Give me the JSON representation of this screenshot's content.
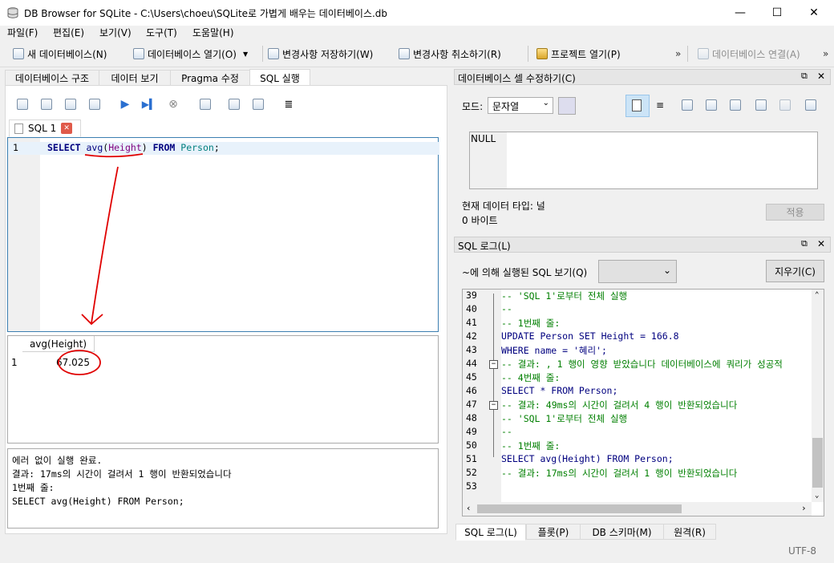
{
  "window": {
    "title": "DB Browser for SQLite - C:\\Users\\choeu\\SQLite로 가볍게 배우는 데이터베이스.db",
    "minimize": "—",
    "maximize": "☐",
    "close": "✕"
  },
  "menu": [
    "파일(F)",
    "편집(E)",
    "보기(V)",
    "도구(T)",
    "도움말(H)"
  ],
  "toolbar": {
    "new_db": "새 데이터베이스(N)",
    "open_db": "데이터베이스 열기(O)",
    "write_changes": "변경사항 저장하기(W)",
    "revert_changes": "변경사항 취소하기(R)",
    "open_project": "프로젝트 열기(P)",
    "overflow1": "»",
    "attach_db": "데이터베이스 연결(A)",
    "overflow2": "»"
  },
  "main_tabs": [
    "데이터베이스 구조",
    "데이터 보기",
    "Pragma 수정",
    "SQL 실행"
  ],
  "sql_tab": {
    "label": "SQL 1",
    "close": "✕"
  },
  "editor": {
    "line_number": "1",
    "tokens": [
      "SELECT",
      " ",
      "avg",
      "(",
      "Height",
      ")",
      " ",
      "FROM",
      " ",
      "Person",
      ";"
    ]
  },
  "results": {
    "column": "avg(Height)",
    "row_number": "1",
    "value": "67.025"
  },
  "message": {
    "line1": "에러 없이 실행 완료.",
    "line2": "결과: 17ms의 시간이 걸려서 1 행이 반환되었습니다",
    "line3": "1번째 줄:",
    "line4": "SELECT avg(Height) FROM Person;"
  },
  "cell_editor": {
    "title": "데이터베이스 셀 수정하기(C)",
    "mode_label": "모드:",
    "mode_value": "문자열",
    "content": "NULL",
    "type_label": "현재 데이터 타입: 널",
    "size_label": "0 바이트",
    "apply": "적용"
  },
  "sql_log": {
    "title": "SQL 로그(L)",
    "filter_label": "~에 의해 실행된 SQL 보기(Q)",
    "clear": "지우기(C)",
    "lines": [
      {
        "n": "39",
        "text": "-- 'SQL 1'로부터 전체 실행",
        "cls": "cmt"
      },
      {
        "n": "40",
        "text": "--",
        "cls": "cmt"
      },
      {
        "n": "41",
        "text": "-- 1번째 줄:",
        "cls": "cmt"
      },
      {
        "n": "42",
        "text": "UPDATE Person SET Height = 166.8",
        "cls": "sql1"
      },
      {
        "n": "43",
        "text": "WHERE name = '혜리';",
        "cls": "sql2"
      },
      {
        "n": "44",
        "text": "-- 결과: , 1 행이 영향 받았습니다 데이터베이스에 쿼리가 성공적",
        "cls": "cmt"
      },
      {
        "n": "45",
        "text": "-- 4번째 줄:",
        "cls": "cmt"
      },
      {
        "n": "46",
        "text": "SELECT * FROM Person;",
        "cls": "sql3"
      },
      {
        "n": "47",
        "text": "-- 결과: 49ms의 시간이 걸려서 4 행이 반환되었습니다",
        "cls": "cmt"
      },
      {
        "n": "48",
        "text": "-- 'SQL 1'로부터 전체 실행",
        "cls": "cmt"
      },
      {
        "n": "49",
        "text": "--",
        "cls": "cmt"
      },
      {
        "n": "50",
        "text": "-- 1번째 줄:",
        "cls": "cmt"
      },
      {
        "n": "51",
        "text": "SELECT avg(Height) FROM Person;",
        "cls": "sql4"
      },
      {
        "n": "52",
        "text": "-- 결과: 17ms의 시간이 걸려서 1 행이 반환되었습니다",
        "cls": "cmt"
      },
      {
        "n": "53",
        "text": "",
        "cls": "cmt"
      }
    ]
  },
  "bottom_tabs": [
    "SQL 로그(L)",
    "플롯(P)",
    "DB 스키마(M)",
    "원격(R)"
  ],
  "status": {
    "encoding": "UTF-8"
  },
  "colors": {
    "annotation": "#e00000",
    "selection": "#cce4f7",
    "editor_border": "#3c7fb1"
  }
}
